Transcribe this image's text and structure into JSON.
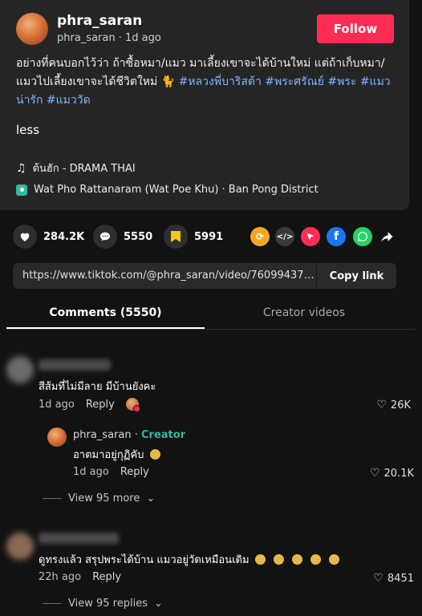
{
  "post": {
    "author_name": "phra_saran",
    "author_handle": "phra_saran",
    "time_ago": "1d ago",
    "follow_label": "Follow",
    "caption_text": "อย่างที่คนบอกไว้ว่า ถ้าซื้อหมา/แมว มาเลี้ยงเขาจะได้บ้านใหม่ แต่ถ้าเก็บหมา/แมวไปเลี้ยงเขาจะได้ชีวิตใหม่ 🐈",
    "hashtags": [
      "#หลวงพี่บาริสต้า",
      "#พระศรัณย์",
      "#พระ",
      "#แมวน่ารัก",
      "#แมววัด"
    ],
    "less_label": "less",
    "music": "ต้นฮัก - DRAMA THAI",
    "location": "Wat Pho Rattanaram (Wat Poe Khu) · Ban Pong District"
  },
  "actions": {
    "likes": "284.2K",
    "comments": "5550",
    "saves": "5991"
  },
  "share": {
    "url": "https://www.tiktok.com/@phra_saran/video/7609943766...",
    "copy_label": "Copy link"
  },
  "tabs": {
    "comments_label": "Comments (5550)",
    "creator_label": "Creator videos"
  },
  "comments": [
    {
      "text": "สีส้มที่ไม่มีลาย มีบ้านยังคะ",
      "time": "1d ago",
      "reply_label": "Reply",
      "likes": "26K",
      "reply": {
        "author": "phra_saran",
        "creator_label": "Creator",
        "text": "อาตมาอยู่กุฏิคับ",
        "time": "1d ago",
        "reply_label": "Reply",
        "likes": "20.1K"
      },
      "view_more": "View 95 more"
    },
    {
      "text": "ดูทรงแล้ว สรุปพระได้บ้าน แมวอยู่วัดเหมือนเดิม",
      "time": "22h ago",
      "reply_label": "Reply",
      "likes": "8451",
      "view_more": "View 95 replies"
    }
  ],
  "colors": {
    "follow": "#fe2c55",
    "hashtag": "#7fb6ff",
    "creator": "#2fb9a3",
    "save": "#f5c518"
  }
}
